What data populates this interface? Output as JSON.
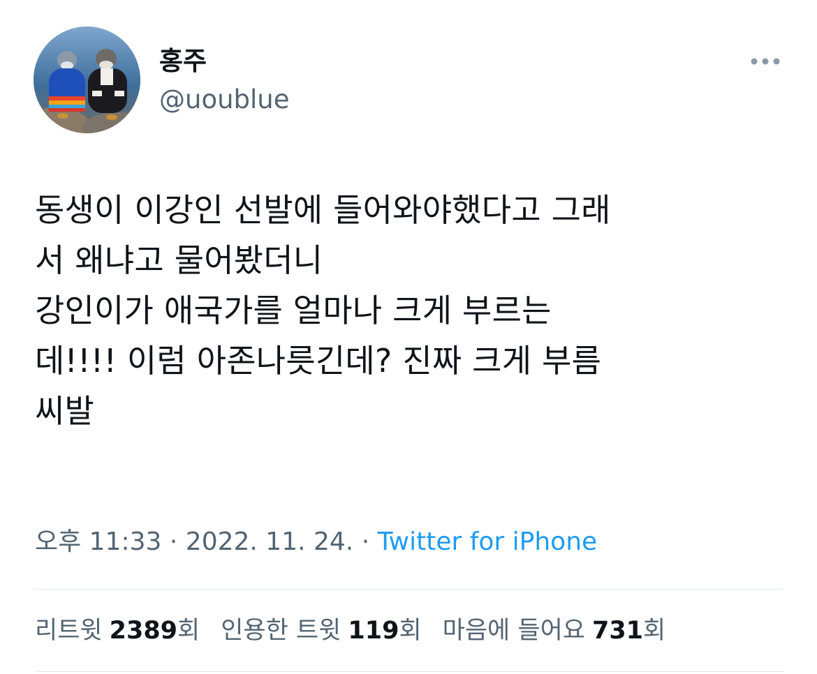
{
  "author": {
    "display_name": "홍주",
    "handle": "@uoublue",
    "avatar": "penguins-in-sweaters-avatar"
  },
  "more_icon": "more-horizontal-icon",
  "tweet": {
    "lines": [
      "동생이 이강인 선발에 들어와야했다고 그래",
      "서 왜냐고 물어봤더니",
      "강인이가 애국가를 얼마나 크게 부르는",
      "데!!!! 이럼 아존나릇긴데? 진짜 크게 부름",
      "씨발"
    ]
  },
  "meta": {
    "time": "오후 11:33",
    "separator": "·",
    "date": "2022. 11. 24.",
    "source": "Twitter for iPhone"
  },
  "stats": {
    "retweets": {
      "label": "리트윗",
      "count": "2389",
      "unit": "회"
    },
    "quotes": {
      "label": "인용한 트윗",
      "count": "119",
      "unit": "회"
    },
    "likes": {
      "label": "마음에 들어요",
      "count": "731",
      "unit": "회"
    }
  },
  "colors": {
    "text_primary": "#0f1419",
    "text_secondary": "#536471",
    "link": "#1d9bf0",
    "divider": "#e3e7ea"
  }
}
